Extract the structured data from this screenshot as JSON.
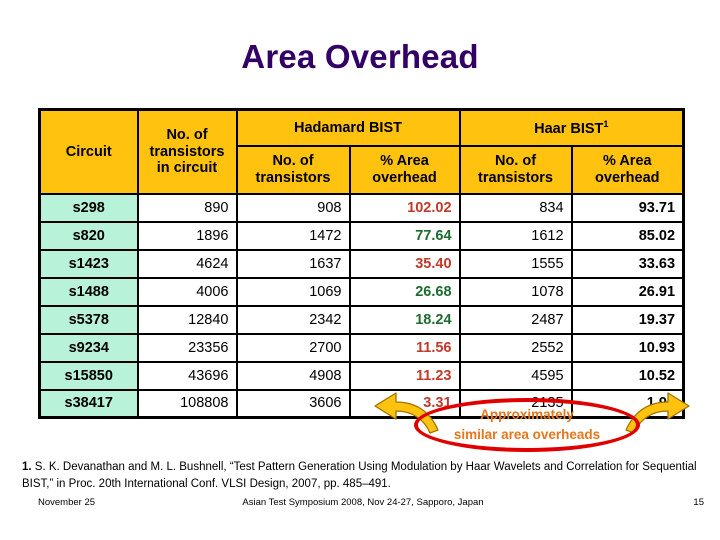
{
  "slide": {
    "title": "Area Overhead"
  },
  "table": {
    "group_headers": {
      "circuit": "Circuit",
      "transistors_in_circuit": "No. of transistors in circuit",
      "hadamard": "Hadamard BIST",
      "haar": "Haar BIST",
      "haar_footnote_marker": "1"
    },
    "sub_headers": {
      "hadamard_transistors": "No. of transistors",
      "hadamard_overhead": "% Area overhead",
      "haar_transistors": "No. of transistors",
      "haar_overhead": "% Area overhead"
    },
    "rows": [
      {
        "circuit": "s298",
        "transistors": "890",
        "had_trans": "908",
        "had_pct": "102.02",
        "had_pct_color": "#C0392B",
        "haar_trans": "834",
        "haar_pct": "93.71"
      },
      {
        "circuit": "s820",
        "transistors": "1896",
        "had_trans": "1472",
        "had_pct": "77.64",
        "had_pct_color": "#1E6B2E",
        "haar_trans": "1612",
        "haar_pct": "85.02"
      },
      {
        "circuit": "s1423",
        "transistors": "4624",
        "had_trans": "1637",
        "had_pct": "35.40",
        "had_pct_color": "#C0392B",
        "haar_trans": "1555",
        "haar_pct": "33.63"
      },
      {
        "circuit": "s1488",
        "transistors": "4006",
        "had_trans": "1069",
        "had_pct": "26.68",
        "had_pct_color": "#1E6B2E",
        "haar_trans": "1078",
        "haar_pct": "26.91"
      },
      {
        "circuit": "s5378",
        "transistors": "12840",
        "had_trans": "2342",
        "had_pct": "18.24",
        "had_pct_color": "#1E6B2E",
        "haar_trans": "2487",
        "haar_pct": "19.37"
      },
      {
        "circuit": "s9234",
        "transistors": "23356",
        "had_trans": "2700",
        "had_pct": "11.56",
        "had_pct_color": "#C0392B",
        "haar_trans": "2552",
        "haar_pct": "10.93"
      },
      {
        "circuit": "s15850",
        "transistors": "43696",
        "had_trans": "4908",
        "had_pct": "11.23",
        "had_pct_color": "#C0392B",
        "haar_trans": "4595",
        "haar_pct": "10.52"
      },
      {
        "circuit": "s38417",
        "transistors": "108808",
        "had_trans": "3606",
        "had_pct": "3.31",
        "had_pct_color": "#C0392B",
        "haar_trans": "2135",
        "haar_pct": "1.96"
      }
    ]
  },
  "callout": {
    "line1": "Approximately",
    "line2": "similar area overheads",
    "text_color": "#E8761A",
    "ellipse_color": "#E00000",
    "arrow_color": "#FFC20E"
  },
  "footnote": {
    "marker": "1.",
    "text": " S. K. Devanathan and M. L. Bushnell, “Test Pattern Generation Using Modulation by Haar Wavelets and Correlation for Sequential BIST,” in Proc. 20th International Conf. VLSI Design, 2007, pp. 485–491."
  },
  "footer": {
    "date": "November 25",
    "event": "Asian Test Symposium 2008, Nov 24-27, Sapporo, Japan",
    "page": "15"
  },
  "colors": {
    "title": "#330066",
    "header_bg": "#FFC20E",
    "circuit_bg": "#B8F2D8",
    "cell_bg": "#FFFFFF",
    "border": "#000000"
  }
}
